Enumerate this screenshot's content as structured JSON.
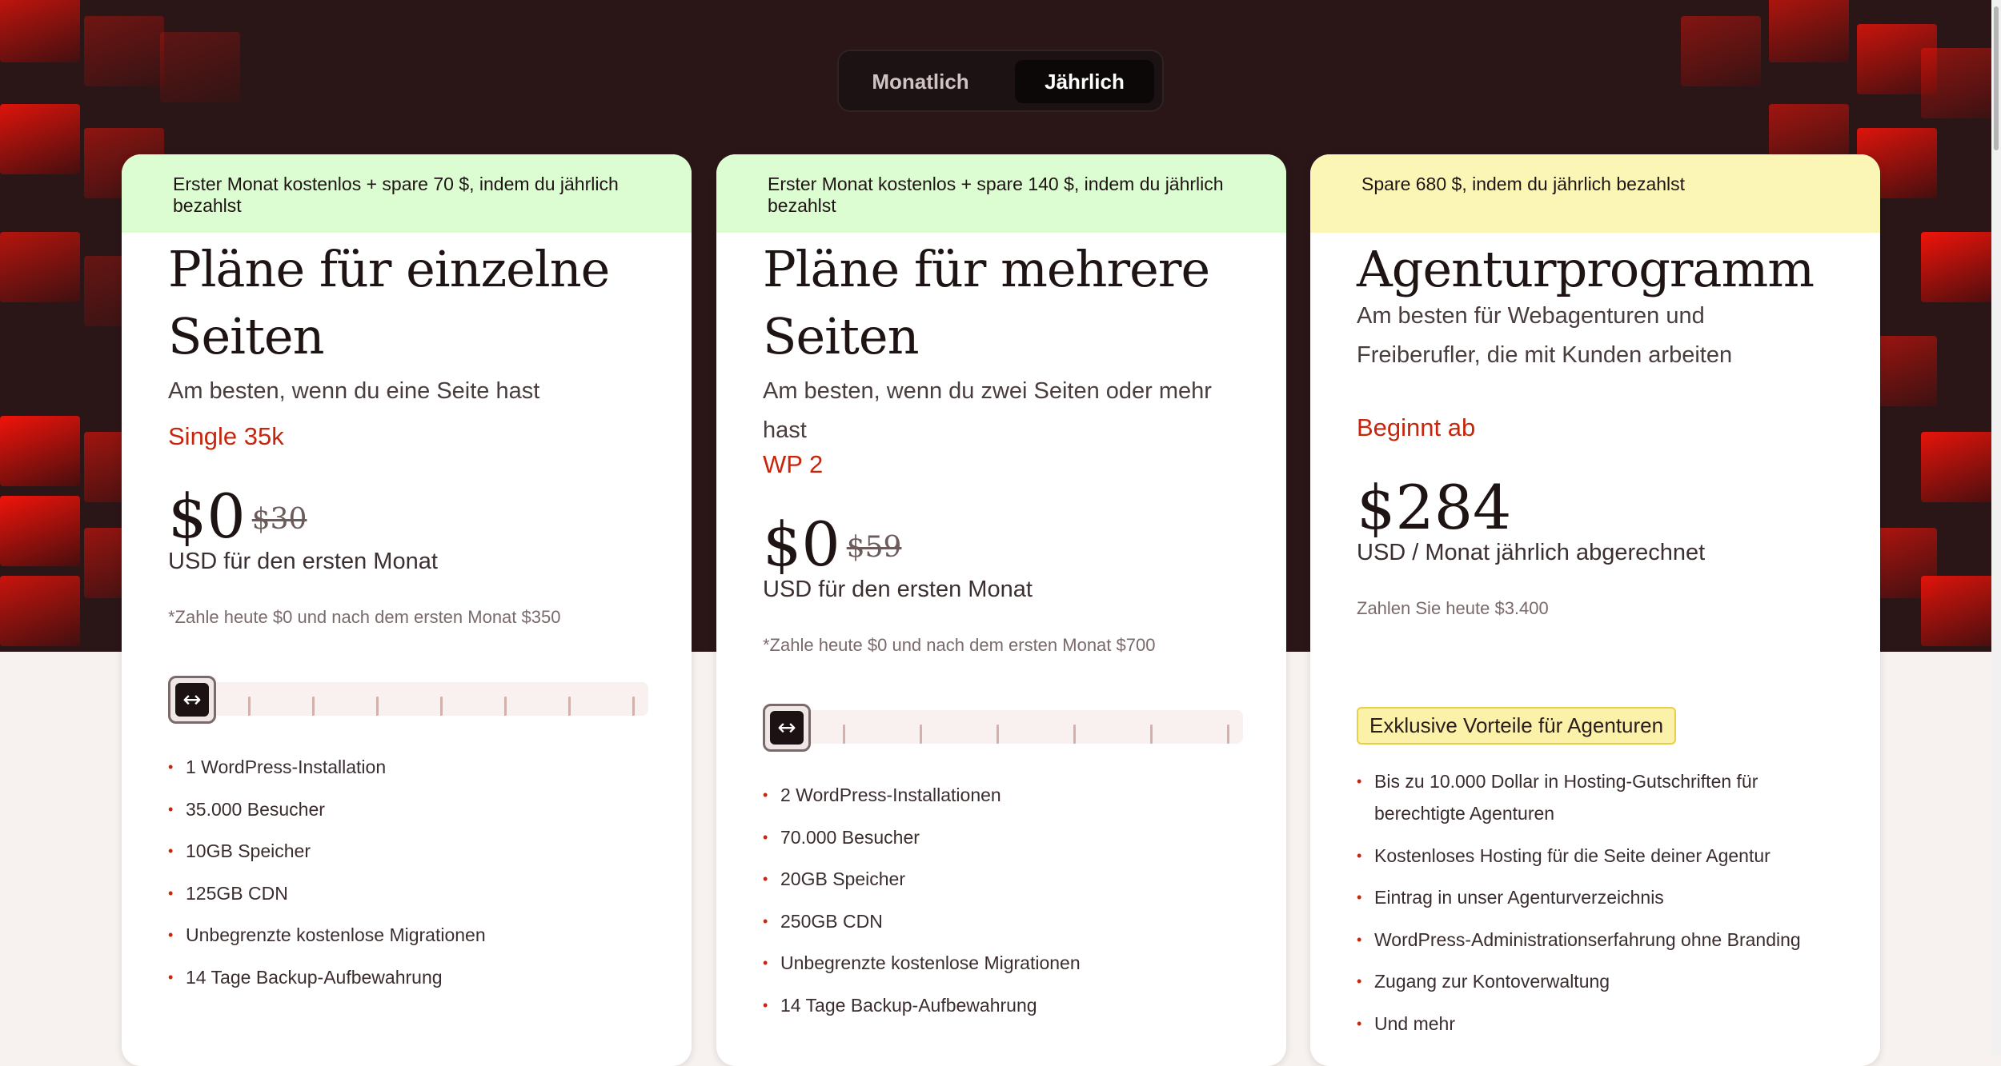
{
  "billing_toggle": {
    "monthly_label": "Monatlich",
    "yearly_label": "Jährlich",
    "selected": "Jährlich"
  },
  "cards": [
    {
      "banner": "Erster Monat kostenlos + spare 70 $, indem du jährlich bezahlst",
      "title": "Pläne für einzelne Seiten",
      "subtitle": "Am besten, wenn du eine Seite hast",
      "plan": "Single 35k",
      "price": "$0",
      "old_price": "$30",
      "price_note": "USD für den ersten Monat",
      "pay_note": "*Zahle heute $0 und nach dem ersten Monat $350",
      "slider_level": 0,
      "features": [
        "1 WordPress-Installation",
        "35.000 Besucher",
        "10GB Speicher",
        "125GB CDN",
        "Unbegrenzte kostenlose Migrationen",
        "14 Tage Backup-Aufbewahrung"
      ]
    },
    {
      "banner": "Erster Monat kostenlos + spare 140 $, indem du jährlich bezahlst",
      "title": "Pläne für mehrere Seiten",
      "subtitle": "Am besten, wenn du zwei Seiten oder mehr hast",
      "plan": "WP 2",
      "price": "$0",
      "old_price": "$59",
      "price_note": "USD für den ersten Monat",
      "pay_note": "*Zahle heute $0 und nach dem ersten Monat $700",
      "slider_level": 0,
      "features": [
        "2 WordPress-Installationen",
        "70.000 Besucher",
        "20GB Speicher",
        "250GB CDN",
        "Unbegrenzte kostenlose Migrationen",
        "14 Tage Backup-Aufbewahrung"
      ]
    },
    {
      "banner": "Spare 680 $, indem du jährlich bezahlst",
      "title": "Agenturprogramm",
      "subtitle": "Am besten für Webagenturen und Freiberufler, die mit Kunden arbeiten",
      "plan": "Beginnt ab",
      "price": "$284",
      "price_note": "USD / Monat jährlich abgerechnet",
      "pay_note": "Zahlen Sie heute $3.400",
      "badge": "Exklusive Vorteile für Agenturen",
      "features": [
        "Bis zu 10.000 Dollar in Hosting-Gutschriften für berechtigte Agenturen",
        "Kostenloses Hosting für die Seite deiner Agentur",
        "Eintrag in unser Agenturverzeichnis",
        "WordPress-Administrationserfahrung ohne Branding",
        "Zugang zur Kontoverwaltung",
        "Und mehr"
      ]
    }
  ],
  "colors": {
    "hero_bg": "#2b1617",
    "accent_red": "#c7260c",
    "banner_green": "#dcfcd2",
    "banner_yellow": "#fcf6b6"
  }
}
